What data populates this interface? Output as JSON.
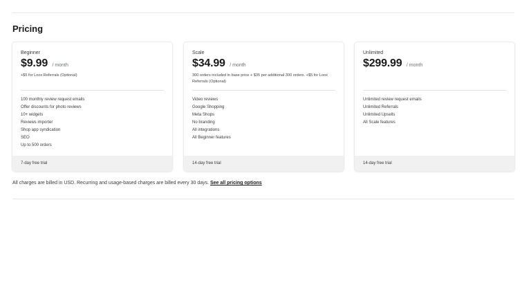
{
  "section_title": "Pricing",
  "plans": [
    {
      "name": "Beginner",
      "price": "$9.99",
      "period": "/ month",
      "note": "+$5 for Loox Referrals (Optional)",
      "features": [
        "100 monthly review request emails",
        "Offer discounts for photo reviews",
        "10+ widgets",
        "Reviews importer",
        "Shop app syndication",
        "SEO",
        "Up to 500 orders"
      ],
      "trial": "7-day free trial"
    },
    {
      "name": "Scale",
      "price": "$34.99",
      "period": "/ month",
      "note": "300 orders included in base price + $35 per additional 300 orders. +$5 for Loox Referrals (Optional)",
      "features": [
        "Video reviews",
        "Google Shopping",
        "Meta Shops",
        "No branding",
        "All integrations",
        "All Beginner features"
      ],
      "trial": "14-day free trial"
    },
    {
      "name": "Unlimited",
      "price": "$299.99",
      "period": "/ month",
      "note": "",
      "features": [
        "Unlimited review request emails",
        "Unlimited Referrals",
        "Unlimited Upsells",
        "All Scale features"
      ],
      "trial": "14-day free trial"
    }
  ],
  "footnote": {
    "text": "All charges are billed in USD. Recurring and usage-based charges are billed every 30 days.",
    "link_label": "See all pricing options"
  }
}
